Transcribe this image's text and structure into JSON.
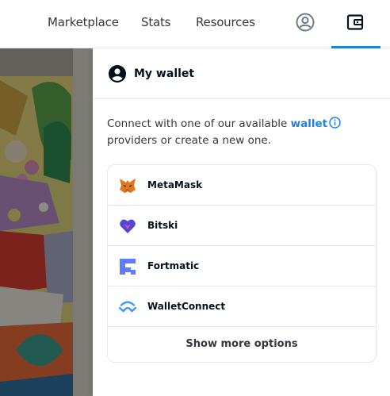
{
  "nav": {
    "links": [
      {
        "label": "Marketplace"
      },
      {
        "label": "Stats"
      },
      {
        "label": "Resources"
      }
    ],
    "icons": [
      "account-circle-icon",
      "wallet-icon"
    ],
    "accent_color": "#2081e2"
  },
  "panel": {
    "title": "My wallet",
    "intro_before": "Connect with one of our available ",
    "intro_link": "wallet",
    "intro_after": " providers or create a new one.",
    "providers": [
      {
        "name": "MetaMask",
        "icon": "metamask-fox-icon"
      },
      {
        "name": "Bitski",
        "icon": "bitski-icon"
      },
      {
        "name": "Fortmatic",
        "icon": "fortmatic-icon"
      },
      {
        "name": "WalletConnect",
        "icon": "walletconnect-icon"
      }
    ],
    "show_more": "Show more options"
  }
}
